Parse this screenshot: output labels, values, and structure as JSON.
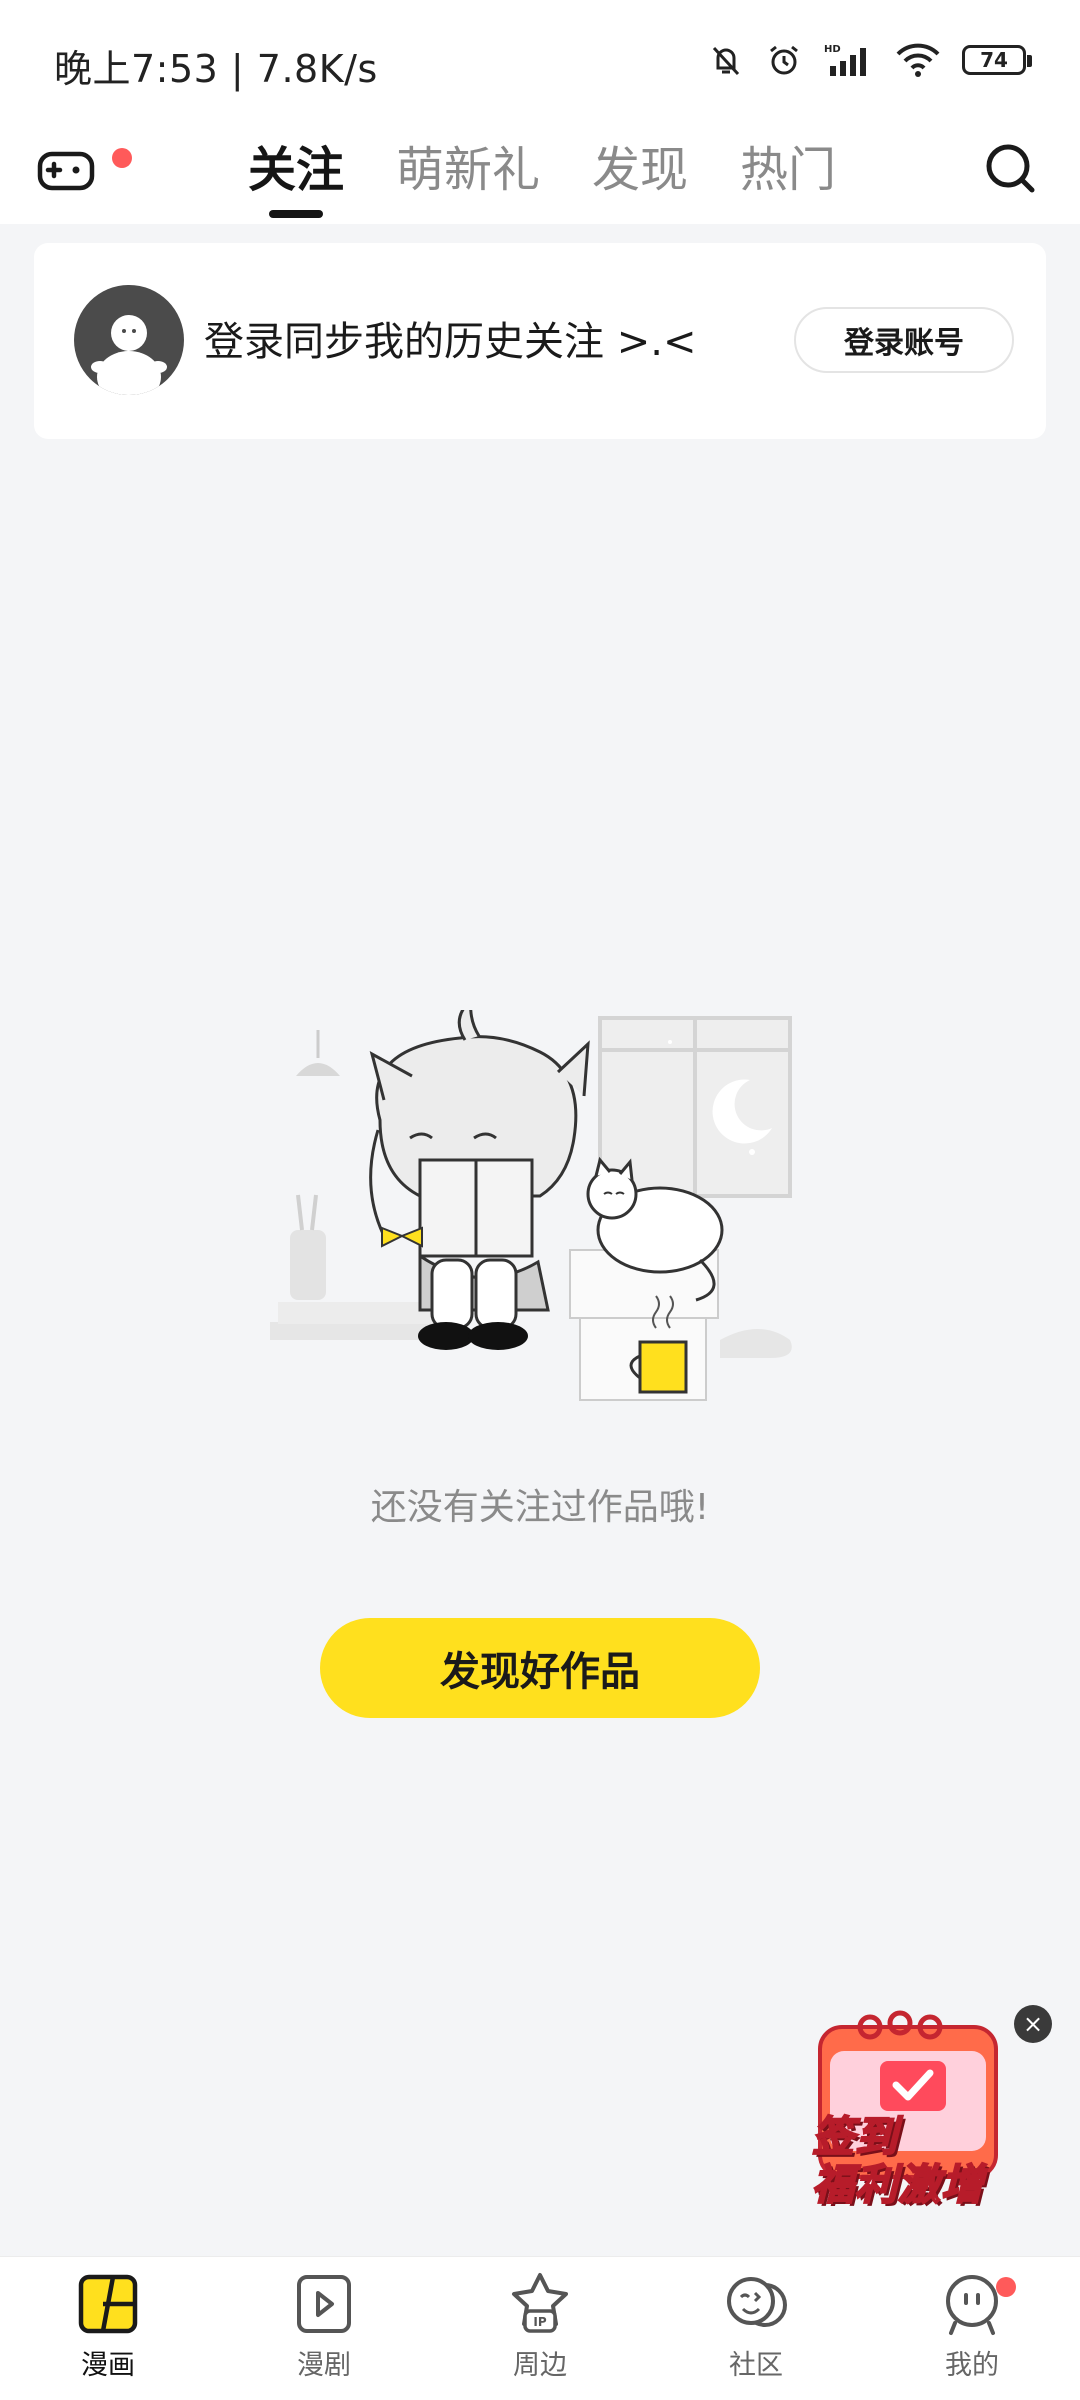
{
  "status_bar": {
    "time": "晚上7:53 | 7.8K/s",
    "battery": "74",
    "icons": [
      "mute-bell-icon",
      "alarm-icon",
      "hd-signal-icon",
      "wifi-icon",
      "battery-icon"
    ]
  },
  "top_nav": {
    "tabs": [
      {
        "label": "关注",
        "active": true
      },
      {
        "label": "萌新礼",
        "active": false
      },
      {
        "label": "发现",
        "active": false
      },
      {
        "label": "热门",
        "active": false
      }
    ],
    "left_icon": "gamepad-icon",
    "right_icon": "search-icon"
  },
  "login_card": {
    "text": "登录同步我的历史关注 >.<",
    "button": "登录账号"
  },
  "empty_state": {
    "message": "还没有关注过作品哦!",
    "button": "发现好作品"
  },
  "floating_badge": {
    "line1": "签到",
    "line2": "福利激增",
    "close": "×"
  },
  "bottom_nav": {
    "items": [
      {
        "label": "漫画",
        "icon": "comic-icon",
        "active": true
      },
      {
        "label": "漫剧",
        "icon": "play-icon",
        "active": false
      },
      {
        "label": "周边",
        "icon": "ip-star-icon",
        "active": false
      },
      {
        "label": "社区",
        "icon": "community-icon",
        "active": false
      },
      {
        "label": "我的",
        "icon": "profile-icon",
        "active": false
      }
    ]
  },
  "colors": {
    "accent_yellow": "#ffe01e",
    "background": "#f4f5f7",
    "notification_red": "#ff5a5a"
  }
}
